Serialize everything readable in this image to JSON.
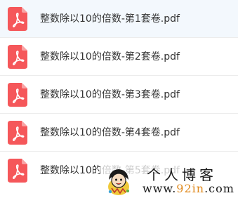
{
  "files": [
    {
      "name": "整数除以10的倍数-第1套卷.pdf",
      "icon": "pdf-file-icon",
      "highlighted": true
    },
    {
      "name": "整数除以10的倍数-第2套卷.pdf",
      "icon": "pdf-file-icon",
      "highlighted": false
    },
    {
      "name": "整数除以10的倍数-第3套卷.pdf",
      "icon": "pdf-file-icon",
      "highlighted": false
    },
    {
      "name": "整数除以10的倍数-第4套卷.pdf",
      "icon": "pdf-file-icon",
      "highlighted": false
    },
    {
      "name": "整数除以10的倍数-第5套卷.pdf",
      "icon": "pdf-file-icon",
      "highlighted": false
    }
  ],
  "watermark": {
    "title": "个人博客",
    "url_prefix": "www.",
    "url_accent": "92in",
    "url_suffix": ".com"
  },
  "colors": {
    "pdf_icon": "#f5575a",
    "row_highlight": "#f3f8fd",
    "text": "#333333",
    "url_accent": "#e08a1e"
  }
}
